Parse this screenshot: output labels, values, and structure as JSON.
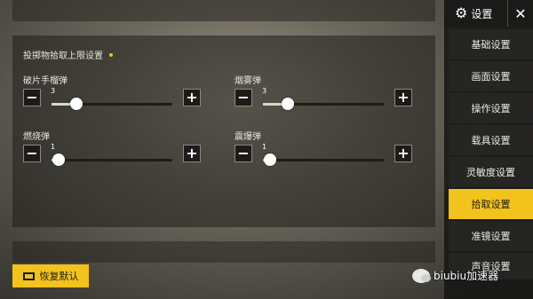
{
  "settings_header": {
    "title": "设置",
    "icon": "gear-icon",
    "close_icon": "close-icon"
  },
  "section": {
    "title": "投掷物拾取上限设置"
  },
  "sliders": [
    {
      "label": "破片手榴弹",
      "value": "3",
      "fraction": 0.15
    },
    {
      "label": "烟雾弹",
      "value": "3",
      "fraction": 0.15
    },
    {
      "label": "燃烧弹",
      "value": "1",
      "fraction": 0.0
    },
    {
      "label": "震爆弹",
      "value": "1",
      "fraction": 0.0
    }
  ],
  "sidebar": {
    "items": [
      {
        "label": "基础设置"
      },
      {
        "label": "画面设置"
      },
      {
        "label": "操作设置"
      },
      {
        "label": "载具设置"
      },
      {
        "label": "灵敏度设置"
      },
      {
        "label": "拾取设置"
      },
      {
        "label": "准镜设置"
      },
      {
        "label": "声音设置"
      }
    ],
    "active_index": 5
  },
  "footer": {
    "reset_label": "恢复默认"
  },
  "watermark": {
    "text": "biubiu加速器"
  },
  "colors": {
    "accent": "#f2c21d",
    "panel": "#1e1d1a"
  }
}
